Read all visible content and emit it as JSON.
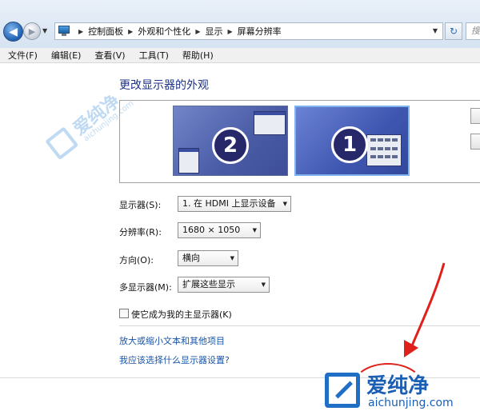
{
  "address_bar": {
    "breadcrumbs": [
      "控制面板",
      "外观和个性化",
      "显示",
      "屏幕分辨率"
    ],
    "search_placeholder": "搜"
  },
  "menu": {
    "items": [
      "文件(F)",
      "编辑(E)",
      "查看(V)",
      "工具(T)",
      "帮助(H)"
    ]
  },
  "main": {
    "title": "更改显示器的外观",
    "monitors": [
      {
        "number": "2",
        "selected": false
      },
      {
        "number": "1",
        "selected": true
      }
    ],
    "display": {
      "label": "显示器(S):",
      "value": "1. 在 HDMI 上显示设备"
    },
    "resolution": {
      "label": "分辨率(R):",
      "value": "1680 × 1050"
    },
    "orientation": {
      "label": "方向(O):",
      "value": "横向"
    },
    "multiple_displays": {
      "label": "多显示器(M):",
      "value": "扩展这些显示"
    },
    "primary_checkbox": {
      "label": "使它成为我的主显示器(K)",
      "checked": false
    },
    "links": [
      "放大或缩小文本和其他项目",
      "我应该选择什么显示器设置?"
    ]
  },
  "watermark": {
    "brand": "爱纯净",
    "url": "aichunjing.com"
  },
  "colors": {
    "title_blue": "#1e3287",
    "link_blue": "#1a55a8",
    "annotation_red": "#e0201a"
  }
}
